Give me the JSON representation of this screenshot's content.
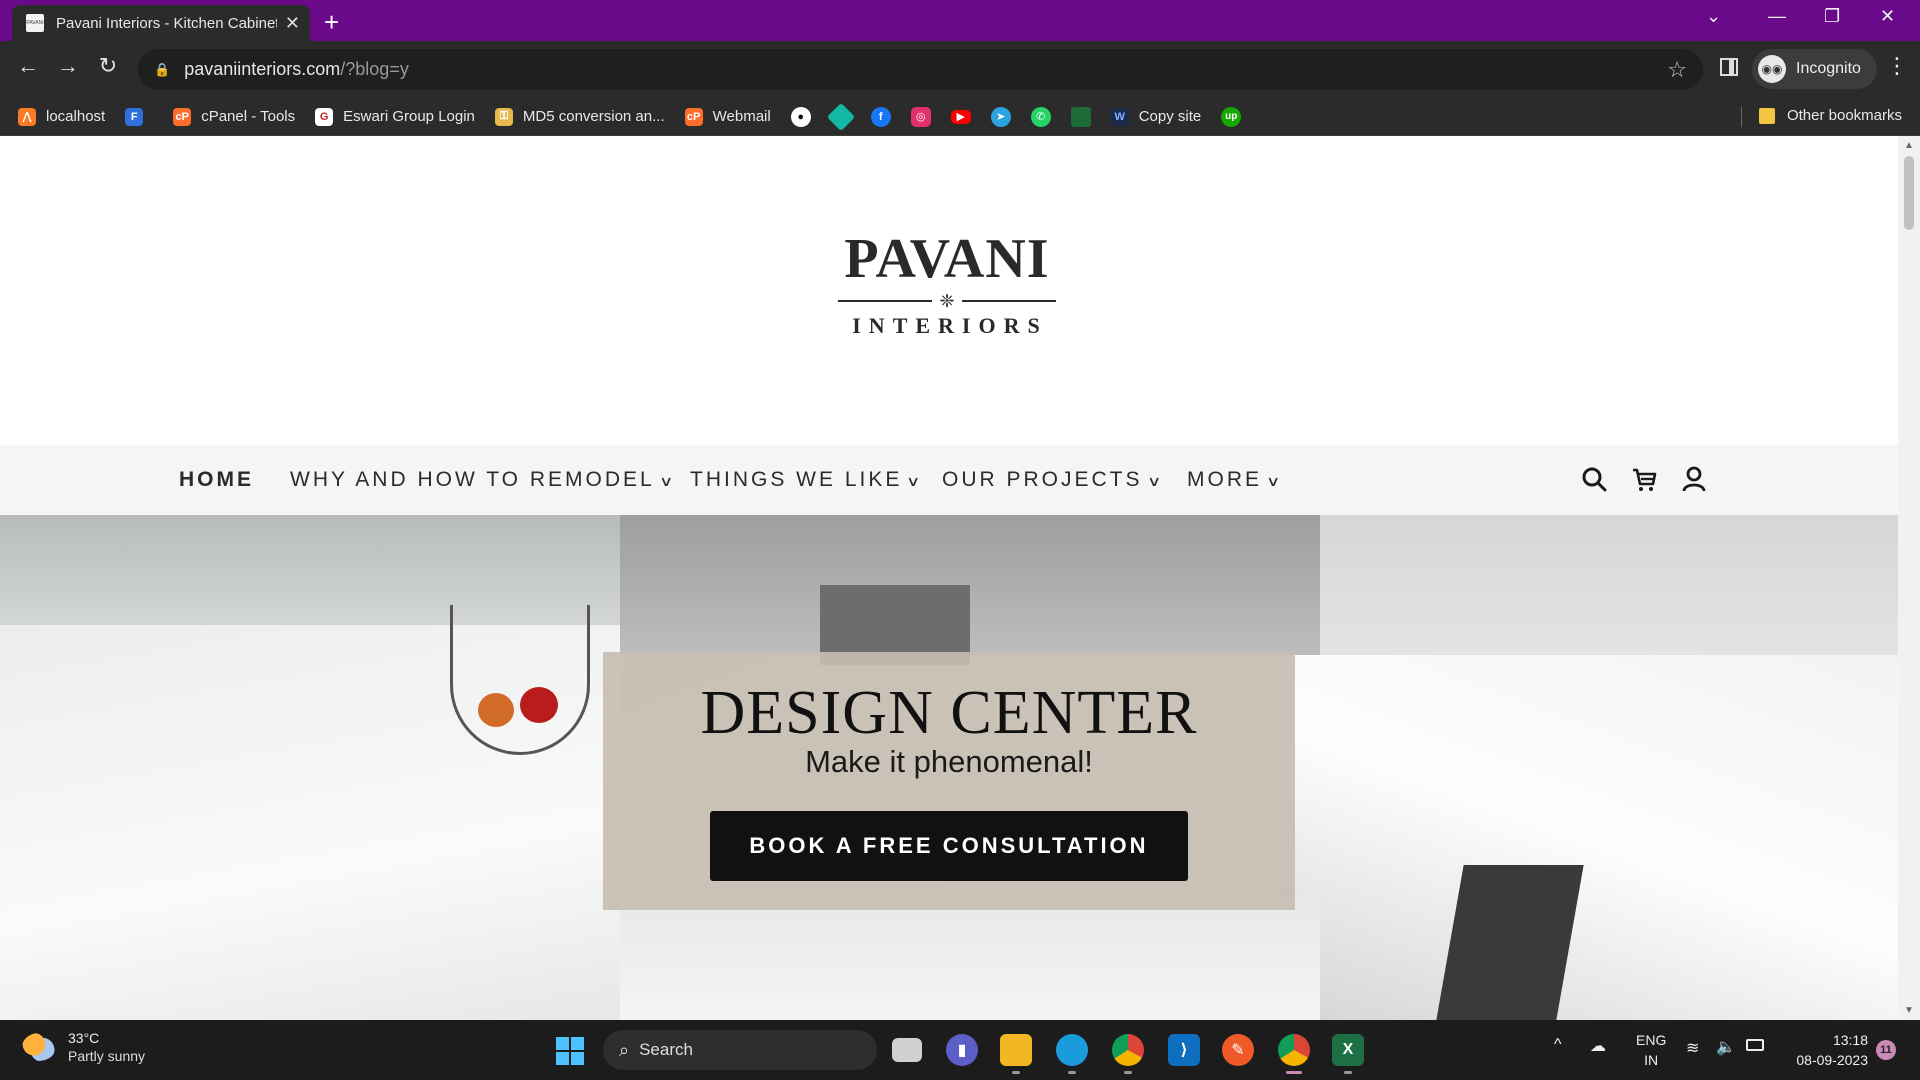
{
  "browser": {
    "tab_title": "Pavani Interiors - Kitchen Cabinet",
    "favicon_text": "PAVANI",
    "new_tab_symbol": "+",
    "url_host": "pavaniinteriors.com",
    "url_path": "/?blog=y",
    "profile_label": "Incognito"
  },
  "bookmarks": {
    "items": [
      {
        "label": "localhost",
        "icon": "xampp-icon",
        "color": "#fb7a24"
      },
      {
        "label": "",
        "icon": "forms-icon",
        "color": "#2f6fde"
      },
      {
        "label": "cPanel - Tools",
        "icon": "cpanel-icon",
        "color": "#ff6c2c"
      },
      {
        "label": "Eswari Group Login",
        "icon": "eswari-icon",
        "color": "#ffffff"
      },
      {
        "label": "MD5 conversion an...",
        "icon": "key-icon",
        "color": "#e6b84d"
      },
      {
        "label": "Webmail",
        "icon": "cpanel-icon",
        "color": "#ff6c2c"
      }
    ],
    "icon_only": [
      {
        "icon": "github-icon",
        "color": "#ffffff"
      },
      {
        "icon": "diamond-icon",
        "color": "#14b8a6"
      },
      {
        "icon": "facebook-icon",
        "color": "#1877f2"
      },
      {
        "icon": "instagram-icon",
        "color": "#e1306c"
      },
      {
        "icon": "youtube-icon",
        "color": "#ff0000"
      },
      {
        "icon": "telegram-icon",
        "color": "#2aa3e0"
      },
      {
        "icon": "whatsapp-icon",
        "color": "#25d366"
      },
      {
        "icon": "sheet-icon",
        "color": "#1e6b3a"
      }
    ],
    "copy_site": "Copy site",
    "upwork_label": "up",
    "other": "Other bookmarks"
  },
  "site": {
    "logo_top": "PAVANI",
    "logo_bottom": "INTERIORS",
    "nav": [
      {
        "label": "HOME",
        "has_menu": false
      },
      {
        "label": "WHY AND HOW TO REMODEL",
        "has_menu": true
      },
      {
        "label": "THINGS WE LIKE",
        "has_menu": true
      },
      {
        "label": "OUR PROJECTS",
        "has_menu": true
      },
      {
        "label": "MORE",
        "has_menu": true
      }
    ],
    "hero": {
      "title": "DESIGN CENTER",
      "subtitle": "Make it phenomenal!",
      "cta": "BOOK A FREE CONSULTATION",
      "overlay_color": "#c8beb2"
    }
  },
  "taskbar": {
    "temperature": "33°C",
    "condition": "Partly sunny",
    "search_label": "Search",
    "language": "ENG",
    "region": "IN",
    "time": "13:18",
    "date": "08-09-2023",
    "notifications": "11"
  }
}
